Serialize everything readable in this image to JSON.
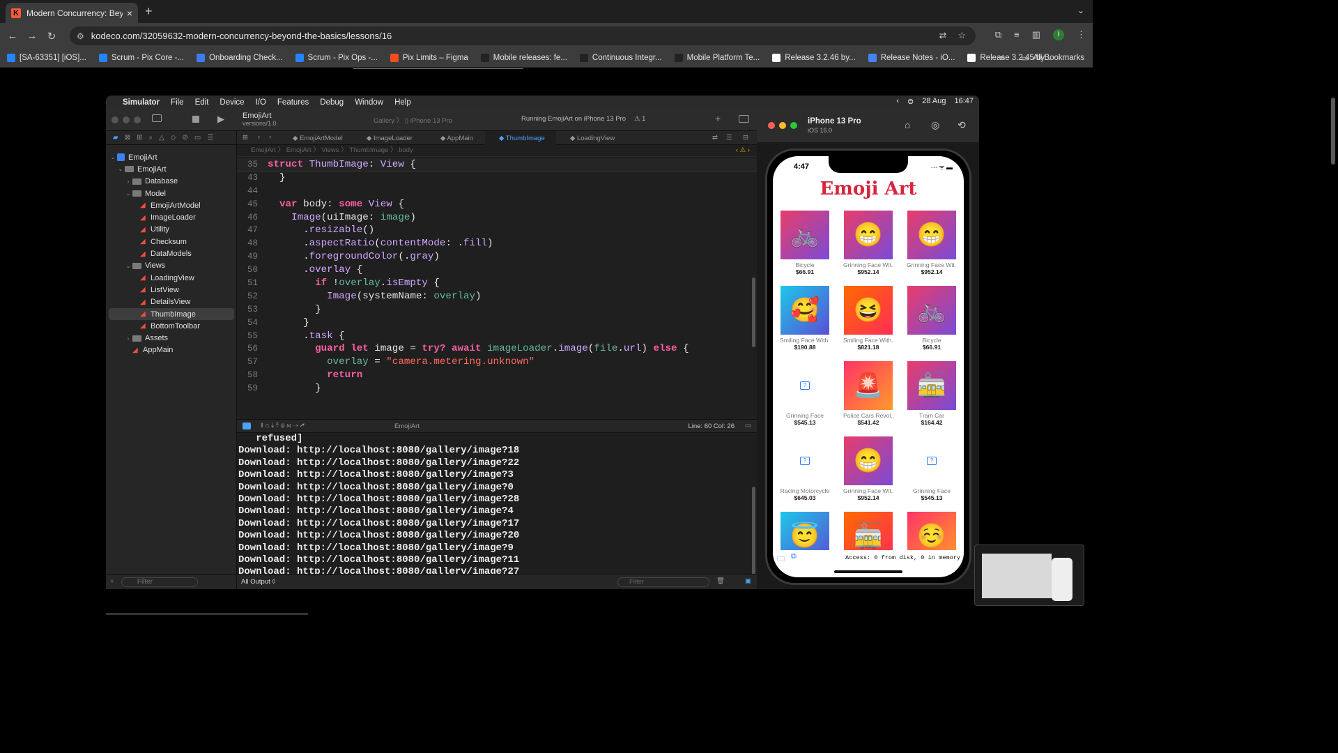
{
  "browser": {
    "tab_title": "Modern Concurrency: Beyond",
    "url": "kodeco.com/32059632-modern-concurrency-beyond-the-basics/lessons/16",
    "bookmarks": [
      {
        "label": "[SA-63351] [iOS]...",
        "color": "#2684ff"
      },
      {
        "label": "Scrum - Pix Core -...",
        "color": "#2684ff"
      },
      {
        "label": "Onboarding Check...",
        "color": "#3d7cf2"
      },
      {
        "label": "Scrum - Pix Ops -...",
        "color": "#2684ff"
      },
      {
        "label": "Pix Limits – Figma",
        "color": "#f24e1e"
      },
      {
        "label": "Mobile releases: fe...",
        "color": "#222"
      },
      {
        "label": "Continuous Integr...",
        "color": "#222"
      },
      {
        "label": "Mobile Platform Te...",
        "color": "#222"
      },
      {
        "label": "Release 3.2.46 by...",
        "color": "#ffffff"
      },
      {
        "label": "Release Notes - iO...",
        "color": "#4285f4"
      },
      {
        "label": "Release 3.2.45 by...",
        "color": "#ffffff"
      }
    ],
    "all_bookmarks": "All Bookmarks",
    "avatar_letter": "I"
  },
  "mac_menu": {
    "items": [
      "Simulator",
      "File",
      "Edit",
      "Device",
      "I/O",
      "Features",
      "Debug",
      "Window",
      "Help"
    ],
    "date": "28 Aug",
    "time": "16:47"
  },
  "xcode": {
    "project": "EmojiArt",
    "version": "versions/1.0",
    "scheme": "Gallery",
    "device": "iPhone 13 Pro",
    "status": "Running EmojiArt on iPhone 13 Pro",
    "warnings": "1",
    "tabs": [
      "EmojiArtModel",
      "ImageLoader",
      "AppMain",
      "ThumbImage",
      "LoadingView"
    ],
    "breadcrumb": [
      "EmojiArt",
      "EmojiArt",
      "Views",
      "ThumbImage",
      "body"
    ],
    "navigator": [
      {
        "label": "EmojiArt",
        "level": 0,
        "kind": "project",
        "open": true
      },
      {
        "label": "EmojiArt",
        "level": 1,
        "kind": "folder",
        "open": true
      },
      {
        "label": "Database",
        "level": 2,
        "kind": "folder",
        "open": false
      },
      {
        "label": "Model",
        "level": 2,
        "kind": "folder",
        "open": true
      },
      {
        "label": "EmojiArtModel",
        "level": 3,
        "kind": "swift"
      },
      {
        "label": "ImageLoader",
        "level": 3,
        "kind": "swift"
      },
      {
        "label": "Utility",
        "level": 3,
        "kind": "swift"
      },
      {
        "label": "Checksum",
        "level": 3,
        "kind": "swift"
      },
      {
        "label": "DataModels",
        "level": 3,
        "kind": "swift"
      },
      {
        "label": "Views",
        "level": 2,
        "kind": "folder",
        "open": true
      },
      {
        "label": "LoadingView",
        "level": 3,
        "kind": "swift"
      },
      {
        "label": "ListView",
        "level": 3,
        "kind": "swift"
      },
      {
        "label": "DetailsView",
        "level": 3,
        "kind": "swift"
      },
      {
        "label": "ThumbImage",
        "level": 3,
        "kind": "swift",
        "selected": true
      },
      {
        "label": "BottomToolbar",
        "level": 3,
        "kind": "swift"
      },
      {
        "label": "Assets",
        "level": 2,
        "kind": "folder",
        "open": false
      },
      {
        "label": "AppMain",
        "level": 2,
        "kind": "swift"
      }
    ],
    "nav_filter": "Filter",
    "sticky_line": {
      "n": "35",
      "tokens": [
        [
          "kw",
          "struct "
        ],
        [
          "ty",
          "ThumbImage"
        ],
        [
          "tx",
          ": "
        ],
        [
          "ty",
          "View"
        ],
        [
          "tx",
          " {"
        ]
      ]
    },
    "code_lines": [
      {
        "n": "43",
        "tokens": [
          [
            "tx",
            "  }"
          ]
        ]
      },
      {
        "n": "44",
        "tokens": []
      },
      {
        "n": "45",
        "tokens": [
          [
            "tx",
            "  "
          ],
          [
            "kw",
            "var "
          ],
          [
            "tx",
            "body: "
          ],
          [
            "kw",
            "some "
          ],
          [
            "ty",
            "View"
          ],
          [
            "tx",
            " {"
          ]
        ]
      },
      {
        "n": "46",
        "tokens": [
          [
            "tx",
            "    "
          ],
          [
            "ty",
            "Image"
          ],
          [
            "tx",
            "(uiImage: "
          ],
          [
            "fn",
            "image"
          ],
          [
            "tx",
            ")"
          ]
        ]
      },
      {
        "n": "47",
        "tokens": [
          [
            "tx",
            "      ."
          ],
          [
            "ty",
            "resizable"
          ],
          [
            "tx",
            "()"
          ]
        ]
      },
      {
        "n": "48",
        "tokens": [
          [
            "tx",
            "      ."
          ],
          [
            "ty",
            "aspectRatio"
          ],
          [
            "tx",
            "("
          ],
          [
            "ty",
            "contentMode"
          ],
          [
            "tx",
            ": ."
          ],
          [
            "ty",
            "fill"
          ],
          [
            "tx",
            ")"
          ]
        ]
      },
      {
        "n": "49",
        "tokens": [
          [
            "tx",
            "      ."
          ],
          [
            "ty",
            "foregroundColor"
          ],
          [
            "tx",
            "(."
          ],
          [
            "ty",
            "gray"
          ],
          [
            "tx",
            ")"
          ]
        ]
      },
      {
        "n": "50",
        "tokens": [
          [
            "tx",
            "      ."
          ],
          [
            "ty",
            "overlay"
          ],
          [
            "tx",
            " {"
          ]
        ]
      },
      {
        "n": "51",
        "tokens": [
          [
            "tx",
            "        "
          ],
          [
            "kw",
            "if "
          ],
          [
            "tx",
            "!"
          ],
          [
            "fn",
            "overlay"
          ],
          [
            "tx",
            "."
          ],
          [
            "ty",
            "isEmpty"
          ],
          [
            "tx",
            " {"
          ]
        ]
      },
      {
        "n": "52",
        "tokens": [
          [
            "tx",
            "          "
          ],
          [
            "ty",
            "Image"
          ],
          [
            "tx",
            "(systemName: "
          ],
          [
            "fn",
            "overlay"
          ],
          [
            "tx",
            ")"
          ]
        ]
      },
      {
        "n": "53",
        "tokens": [
          [
            "tx",
            "        }"
          ]
        ]
      },
      {
        "n": "54",
        "tokens": [
          [
            "tx",
            "      }"
          ]
        ]
      },
      {
        "n": "55",
        "tokens": [
          [
            "tx",
            "      ."
          ],
          [
            "ty",
            "task"
          ],
          [
            "tx",
            " {"
          ]
        ]
      },
      {
        "n": "56",
        "tokens": [
          [
            "tx",
            "        "
          ],
          [
            "kw",
            "guard let "
          ],
          [
            "tx",
            "image = "
          ],
          [
            "kw",
            "try? await "
          ],
          [
            "fn",
            "imageLoader"
          ],
          [
            "tx",
            "."
          ],
          [
            "ty",
            "image"
          ],
          [
            "tx",
            "("
          ],
          [
            "fn",
            "file"
          ],
          [
            "tx",
            "."
          ],
          [
            "ty",
            "url"
          ],
          [
            "tx",
            ") "
          ],
          [
            "kw",
            "else"
          ],
          [
            "tx",
            " {"
          ]
        ]
      },
      {
        "n": "57",
        "tokens": [
          [
            "tx",
            "          "
          ],
          [
            "fn",
            "overlay"
          ],
          [
            "tx",
            " = "
          ],
          [
            "str",
            "\"camera.metering.unknown\""
          ]
        ]
      },
      {
        "n": "58",
        "tokens": [
          [
            "tx",
            "          "
          ],
          [
            "kw",
            "return"
          ]
        ]
      },
      {
        "n": "59",
        "tokens": [
          [
            "tx",
            "        }"
          ]
        ]
      }
    ],
    "debug_target": "EmojiArt",
    "cursor_pos": "Line: 60  Col: 26",
    "console": [
      "   refused]",
      "Download: http://localhost:8080/gallery/image?18",
      "Download: http://localhost:8080/gallery/image?22",
      "Download: http://localhost:8080/gallery/image?3",
      "Download: http://localhost:8080/gallery/image?0",
      "Download: http://localhost:8080/gallery/image?28",
      "Download: http://localhost:8080/gallery/image?4",
      "Download: http://localhost:8080/gallery/image?17",
      "Download: http://localhost:8080/gallery/image?20",
      "Download: http://localhost:8080/gallery/image?9",
      "Download: http://localhost:8080/gallery/image?11",
      "Download: http://localhost:8080/gallery/image?27"
    ],
    "output_selector": "All Output ◊",
    "console_filter": "Filter"
  },
  "simulator": {
    "device": "iPhone 13 Pro",
    "os": "iOS 16.0",
    "clock": "4:47",
    "app_title": "Emoji Art",
    "items": [
      {
        "name": "Bicycle",
        "price": "$66.91",
        "emoji": "🚲",
        "bg": "g1"
      },
      {
        "name": "Grinning Face Wit...",
        "price": "$952.14",
        "emoji": "😁",
        "bg": "g1"
      },
      {
        "name": "Grinning Face Wit...",
        "price": "$952.14",
        "emoji": "😁",
        "bg": "g1"
      },
      {
        "name": "Smiling Face With...",
        "price": "$190.88",
        "emoji": "🥰",
        "bg": "g2"
      },
      {
        "name": "Smiling Face With...",
        "price": "$821.18",
        "emoji": "😆",
        "bg": "g3"
      },
      {
        "name": "Bicycle",
        "price": "$66.91",
        "emoji": "🚲",
        "bg": "g1"
      },
      {
        "name": "Grinning Face",
        "price": "$545.13",
        "emoji": "",
        "bg": "none"
      },
      {
        "name": "Police Cars Revol...",
        "price": "$541.42",
        "emoji": "🚨",
        "bg": "g4"
      },
      {
        "name": "Tram Car",
        "price": "$164.42",
        "emoji": "🚋",
        "bg": "g1"
      },
      {
        "name": "Racing Motorcycle",
        "price": "$645.03",
        "emoji": "",
        "bg": "none"
      },
      {
        "name": "Grinning Face Wit...",
        "price": "$952.14",
        "emoji": "😁",
        "bg": "g1"
      },
      {
        "name": "Grinning Face",
        "price": "$545.13",
        "emoji": "",
        "bg": "none"
      },
      {
        "name": "",
        "price": "",
        "emoji": "😇",
        "bg": "g2"
      },
      {
        "name": "",
        "price": "",
        "emoji": "🚋",
        "bg": "g3"
      },
      {
        "name": "",
        "price": "",
        "emoji": "☺️",
        "bg": "g4"
      }
    ],
    "access_text": "Access: 0 from disk, 0 in memory"
  }
}
